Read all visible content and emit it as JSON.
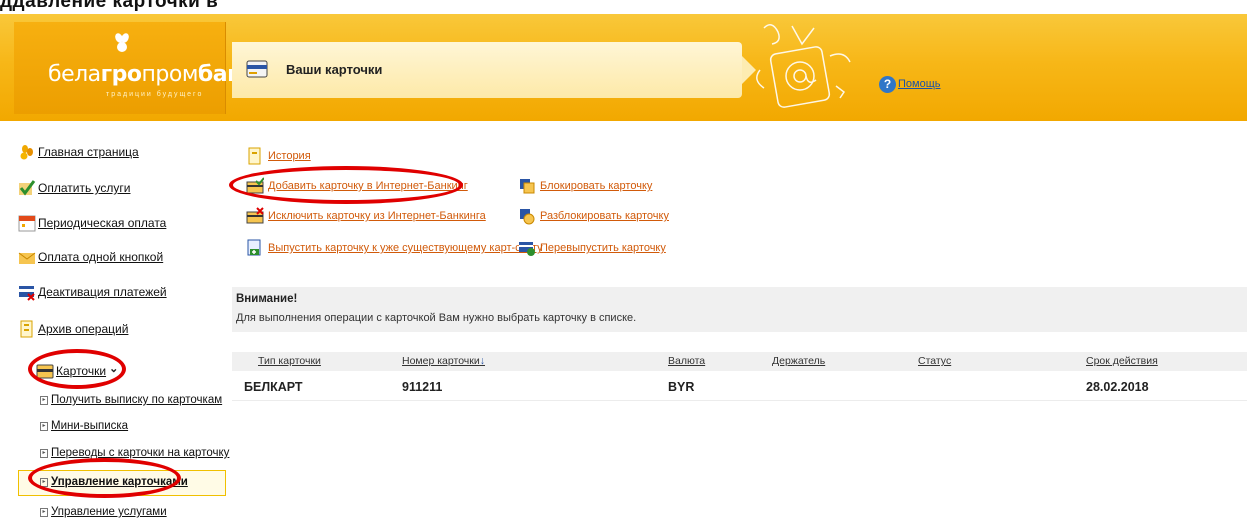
{
  "banner_caption": "ддавление карточки в",
  "logo": {
    "name_light": "бела",
    "name_bold": "гро",
    "name_light2": "пром",
    "name_bold2": "банк",
    "tagline": "традиции будущего"
  },
  "header": {
    "title": "Ваши карточки",
    "help_label": "Помощь",
    "help_glyph": "?"
  },
  "sidebar": {
    "items": [
      {
        "label": "Главная страница",
        "icon": "wheat-icon"
      },
      {
        "label": "Оплатить услуги",
        "icon": "checkmark-icon"
      },
      {
        "label": "Периодическая оплата",
        "icon": "calendar-icon"
      },
      {
        "label": "Оплата одной кнопкой",
        "icon": "envelope-icon"
      },
      {
        "label": "Деактивация платежей",
        "icon": "deactivate-icon"
      },
      {
        "label": "Архив операций",
        "icon": "archive-icon"
      },
      {
        "label": "Карточки",
        "icon": "card-icon",
        "expanded": true
      }
    ],
    "submenu": [
      {
        "label": "Получить выписку по карточкам"
      },
      {
        "label": "Мини-выписка"
      },
      {
        "label": "Переводы с карточки на карточку"
      },
      {
        "label": "Управление карточками",
        "active": true
      },
      {
        "label": "Управление услугами"
      }
    ],
    "chevron": "⌄"
  },
  "actions": {
    "history": "История",
    "add_card": "Добавить карточку в Интернет-Банкинг",
    "remove_card": "Исключить карточку из Интернет-Банкинга",
    "issue_card": "Выпустить карточку к уже существующему карт-счету",
    "block_card": "Блокировать карточку",
    "unblock_card": "Разблокировать карточку",
    "reissue_card": "Перевыпустить карточку"
  },
  "notice": {
    "title": "Внимание!",
    "text": "Для выполнения операции с карточкой Вам нужно выбрать карточку в списке."
  },
  "table": {
    "columns": [
      "Тип карточки",
      "Номер карточки",
      "Валюта",
      "Держатель",
      "Статус",
      "Срок действия"
    ],
    "sort_indicator": "↓",
    "rows": [
      {
        "type": "БЕЛКАРТ",
        "number": "911211",
        "currency": "BYR",
        "holder": "",
        "status": "",
        "expiry": "28.02.2018"
      }
    ]
  },
  "colors": {
    "header_orange": "#f7b718",
    "action_link": "#d15a0a",
    "highlight_ring": "#e00000",
    "help_link": "#1c52a6"
  }
}
